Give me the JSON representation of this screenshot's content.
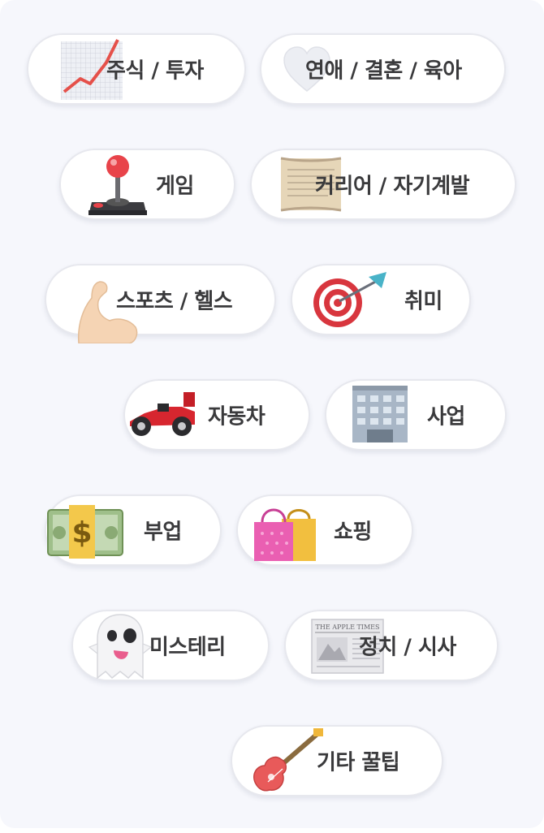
{
  "categories": [
    {
      "label": "주식 / 투자",
      "icon": "stock-chart-icon"
    },
    {
      "label": "연애 / 결혼 / 육아",
      "icon": "heart-icon"
    },
    {
      "label": "게임",
      "icon": "joystick-icon"
    },
    {
      "label": "커리어 / 자기계발",
      "icon": "scroll-icon"
    },
    {
      "label": "스포츠 / 헬스",
      "icon": "flexed-arm-icon"
    },
    {
      "label": "취미",
      "icon": "target-dart-icon"
    },
    {
      "label": "자동차",
      "icon": "race-car-icon"
    },
    {
      "label": "사업",
      "icon": "office-building-icon"
    },
    {
      "label": "부업",
      "icon": "money-stack-icon"
    },
    {
      "label": "쇼핑",
      "icon": "shopping-bags-icon"
    },
    {
      "label": "미스테리",
      "icon": "ghost-icon"
    },
    {
      "label": "정치 / 시사",
      "icon": "newspaper-icon"
    },
    {
      "label": "기타 꿀팁",
      "icon": "guitar-icon"
    }
  ],
  "newspaper_masthead": "THE APPLE TIMES",
  "colors": {
    "panel_bg": "#f6f7fc",
    "pill_bg": "#ffffff",
    "pill_border": "#e7e8ee",
    "label_text": "#3a3a3c"
  }
}
